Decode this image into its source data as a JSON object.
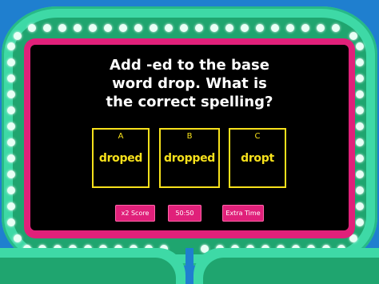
{
  "question": {
    "text": "Add -ed to the base\nword drop. What is\nthe correct spelling?"
  },
  "answers": [
    {
      "letter": "A",
      "text": "droped"
    },
    {
      "letter": "B",
      "text": "dropped"
    },
    {
      "letter": "C",
      "text": "dropt"
    }
  ],
  "powerups": {
    "score_label": "x2 Score",
    "fifty_label": "50:50",
    "time_label": "Extra Time"
  },
  "colors": {
    "background": "#1f7fcf",
    "frame": "#3ed9a6",
    "frame_dark": "#1fa56f",
    "board": "#e0207a",
    "screen": "#000000",
    "answer": "#f7e11b",
    "bulb": "#e8fff5"
  }
}
